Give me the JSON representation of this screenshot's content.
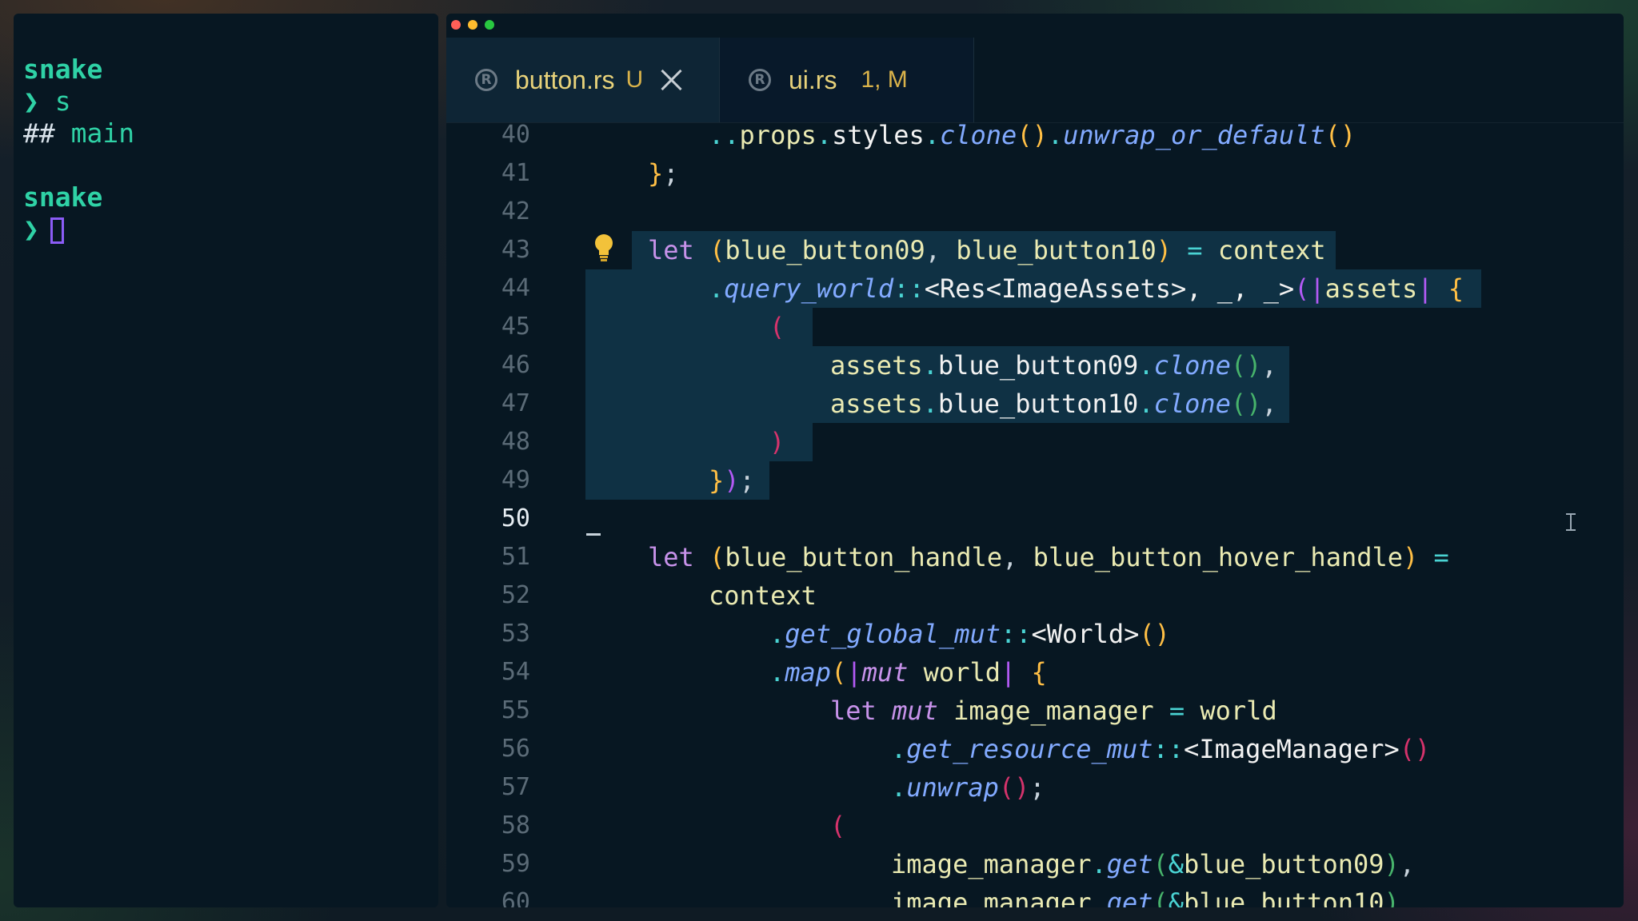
{
  "terminal": {
    "lines": [
      "snake",
      "❯ s",
      "## main",
      "",
      "snake",
      "❯"
    ]
  },
  "editor": {
    "tabs": [
      {
        "name": "button.rs",
        "status": "U",
        "icon": "rust-icon",
        "active": true
      },
      {
        "name": "ui.rs",
        "status": "1, M",
        "icon": "rust-icon",
        "active": false
      }
    ],
    "line_numbers": [
      "40",
      "41",
      "42",
      "43",
      "44",
      "45",
      "46",
      "47",
      "48",
      "49",
      "50",
      "51",
      "52",
      "53",
      "54",
      "55",
      "56",
      "57",
      "58",
      "59",
      "60"
    ],
    "active_line": "50",
    "colors": {
      "traffic": [
        "#ff5f57",
        "#febc2e",
        "#28c840"
      ],
      "selection": "#0f3144"
    }
  }
}
